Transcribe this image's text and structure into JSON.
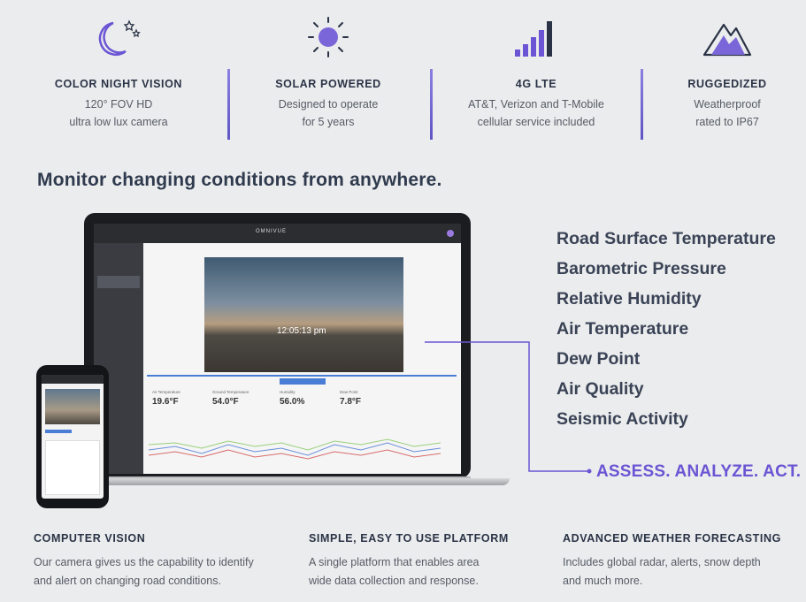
{
  "features": [
    {
      "icon": "moon-stars-icon",
      "title": "COLOR NIGHT VISION",
      "line1": "120° FOV HD",
      "line2": "ultra low lux camera"
    },
    {
      "icon": "sun-icon",
      "title": "SOLAR POWERED",
      "line1": "Designed to operate",
      "line2": "for 5 years"
    },
    {
      "icon": "signal-bars-icon",
      "title": "4G LTE",
      "line1": "AT&T, Verizon and T-Mobile",
      "line2": "cellular service included"
    },
    {
      "icon": "mountain-icon",
      "title": "RUGGEDIZED",
      "line1": "Weatherproof",
      "line2": "rated to IP67"
    }
  ],
  "headline": "Monitor changing conditions from anywhere.",
  "metrics": [
    "Road Surface Temperature",
    "Barometric Pressure",
    "Relative Humidity",
    "Air Temperature",
    "Dew Point",
    "Air Quality",
    "Seismic Activity"
  ],
  "cta": "ASSESS. ANALYZE. ACT.",
  "app": {
    "brand": "OMNIVUE",
    "camera_time": "12:05:13 pm",
    "readings": [
      {
        "label": "Air Temperature",
        "value": "19.6°F"
      },
      {
        "label": "Ground Temperature",
        "value": "54.0°F"
      },
      {
        "label": "Humidity",
        "value": "56.0%"
      },
      {
        "label": "Dew Point",
        "value": "7.8°F"
      }
    ]
  },
  "footer": [
    {
      "title": "COMPUTER VISION",
      "line1": "Our camera gives us the capability to identify",
      "line2": "and alert on changing road conditions."
    },
    {
      "title": "SIMPLE, EASY TO USE PLATFORM",
      "line1": "A single platform that enables area",
      "line2": "wide data collection and response."
    },
    {
      "title": "ADVANCED WEATHER FORECASTING",
      "line1": "Includes global radar, alerts, snow depth",
      "line2": "and much more."
    }
  ],
  "colors": {
    "accent": "#6b55d4",
    "divider": "#7b6fd8",
    "text": "#2a3346"
  }
}
